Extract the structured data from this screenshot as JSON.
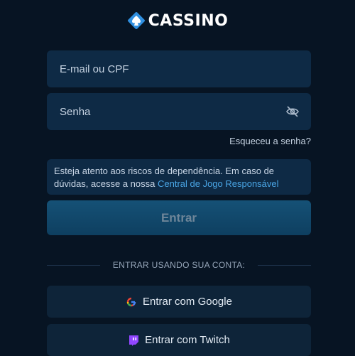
{
  "brand": {
    "name": "CASSINO",
    "logo_icon": "diamond-spade-icon"
  },
  "login": {
    "email_placeholder": "E-mail ou CPF",
    "password_placeholder": "Senha",
    "password_toggle_icon": "eye-off-icon",
    "forgot_label": "Esqueceu a senha?",
    "notice_text": "Esteja atento aos riscos de dependência. Em caso de dúvidas, acesse a nossa ",
    "notice_link": "Central de Jogo Responsável",
    "submit_label": "Entrar"
  },
  "social": {
    "divider_label": "ENTRAR USANDO SUA CONTA:",
    "google_label": "Entrar com Google",
    "google_icon": "google-icon",
    "twitch_label": "Entrar com Twitch",
    "twitch_icon": "twitch-icon"
  },
  "colors": {
    "background": "#071423",
    "field": "#0e2a45",
    "link": "#4aa6e6",
    "submit": "#155176"
  }
}
